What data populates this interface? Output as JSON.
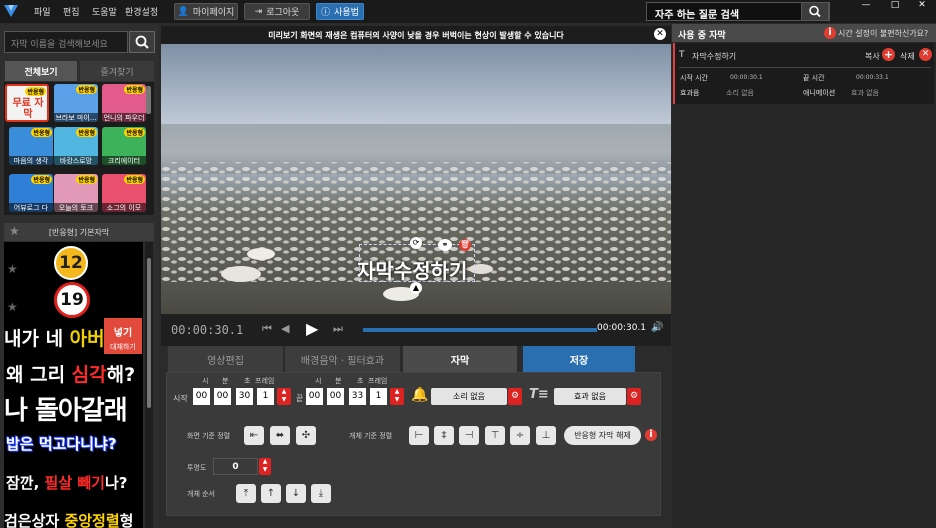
{
  "menu": [
    "파일",
    "편집",
    "도움말",
    "환경설정"
  ],
  "toolbar": {
    "mypage": "마이페이지",
    "logout": "로그아웃",
    "help": "사용법"
  },
  "faq": {
    "label": "자주 하는 질문 검색"
  },
  "window_buttons": [
    "—",
    "□",
    "✕"
  ],
  "left": {
    "search_placeholder": "자막 이름을 검색해보세요",
    "tabs": [
      "전체보기",
      "즐겨찾기"
    ],
    "thumbnails": [
      {
        "badge": "반응형",
        "caption": "무료 자막",
        "color": "#f3f3f3"
      },
      {
        "badge": "반응형",
        "caption": "브라보 마이...",
        "color": "#5aa0e8"
      },
      {
        "badge": "반응형",
        "caption": "언니의 파우더",
        "color": "#e35b8b"
      },
      {
        "badge": "반응형",
        "caption": "마음의 생각",
        "color": "#3a8dd8"
      },
      {
        "badge": "반응형",
        "caption": "바캉스로망",
        "color": "#51b7e0"
      },
      {
        "badge": "반응형",
        "caption": "크리에이터",
        "color": "#3db25a"
      },
      {
        "badge": "반응형",
        "caption": "어뷰로그 다",
        "color": "#2f7fd6"
      },
      {
        "badge": "반응형",
        "caption": "오늘의 토크",
        "color": "#e39ab8"
      },
      {
        "badge": "반응형",
        "caption": "소그의 이모",
        "color": "#e8506d"
      }
    ],
    "category": "[반응형] 기본자막",
    "preview": {
      "circle_12": "12",
      "circle_19": "19",
      "line1_a": "내가 네 ",
      "line1_b": "아버",
      "insert": "넣기",
      "replace": "대체하기",
      "line2_a": "왜 그리 ",
      "line2_b": "심각",
      "line2_c": "해?",
      "line3": "나 돌아갈래",
      "line4": "밥은 먹고다니냐?",
      "line5_a": "잠깐, ",
      "line5_b": "필살 빼기",
      "line5_c": "나?",
      "line6_a": "검은상자 ",
      "line6_b": "중앙정렬",
      "line6_c": "형"
    }
  },
  "video": {
    "notice": "미리보기 화면의 재생은 컴퓨터의 사양이 낮을 경우 버벅이는 현상이 발생할 수 있습니다",
    "subtitle": "자막수정하기",
    "current_time": "00:00:30.1",
    "end_time": "00:00:30.1"
  },
  "bottom_tabs": [
    "영상편집",
    "배경음악 · 필터효과",
    "자막",
    "저장"
  ],
  "edit": {
    "labels": {
      "start": "시작",
      "end": "끝",
      "hour": "시",
      "min": "분",
      "sec": "초",
      "frame": "프레임"
    },
    "start": [
      "00",
      "00",
      "30",
      "1"
    ],
    "end": [
      "00",
      "00",
      "33",
      "1"
    ],
    "sound": "소리 없음",
    "effect": "효과 없음",
    "screen_align": "화면 기준 정렬",
    "object_align": "개체 기준 정렬",
    "release": "반응형 자막 해제",
    "opacity_label": "투명도",
    "opacity_value": "0",
    "order_label": "개체 순서"
  },
  "right": {
    "title": "사용 중 자막",
    "time_help": "시간 설정이 불편하신가요?",
    "item_name": "자막수정하기",
    "copy": "복사",
    "delete": "삭제",
    "start_label": "시작 시간",
    "start_value": "00:00:30.1",
    "end_label": "끝 시간",
    "end_value": "00:00:33.1",
    "sfx_label": "효과음",
    "sfx_value": "소리 없음",
    "anim_label": "애니메이션",
    "anim_value": "효과 없음"
  }
}
